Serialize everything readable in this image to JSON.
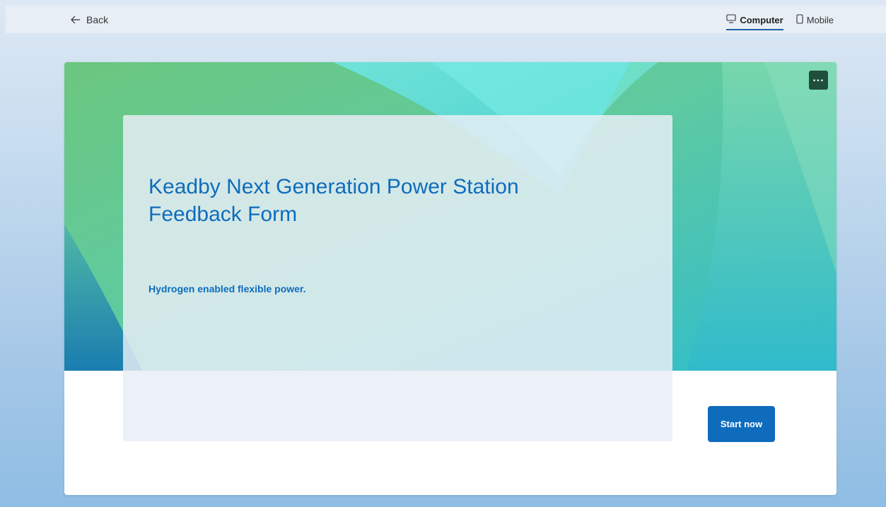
{
  "topbar": {
    "back_label": "Back",
    "back_icon": "arrow-left-icon",
    "views": [
      {
        "label": "Computer",
        "icon": "monitor-icon",
        "active": true
      },
      {
        "label": "Mobile",
        "icon": "phone-icon",
        "active": false
      }
    ]
  },
  "form": {
    "title": "Keadby Next Generation Power Station Feedback Form",
    "subtitle": "Hydrogen enabled flexible power.",
    "more_icon": "more-options-icon",
    "start_label": "Start now"
  },
  "colors": {
    "accent": "#0f6cbd",
    "more_button": "#1f4f3b",
    "hero_green": "#65c67f",
    "hero_teal": "#30bccd",
    "hero_blue": "#1c7eb0"
  }
}
